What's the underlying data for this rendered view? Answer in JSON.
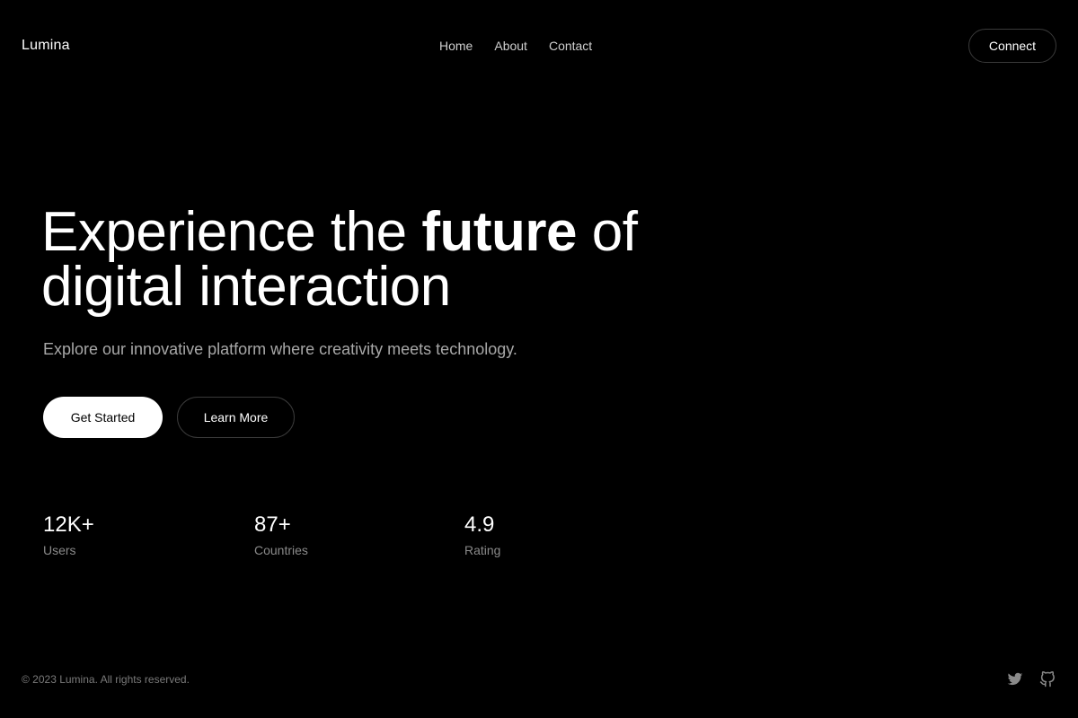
{
  "brand": {
    "name": "Lumina"
  },
  "nav": {
    "items": [
      {
        "label": "Home"
      },
      {
        "label": "About"
      },
      {
        "label": "Contact"
      }
    ]
  },
  "header": {
    "connect_label": "Connect"
  },
  "hero": {
    "title_prefix": "Experience the ",
    "title_emphasis": "future",
    "title_suffix": " of digital interaction",
    "subtitle": "Explore our innovative platform where creativity meets technology.",
    "primary_cta": "Get Started",
    "secondary_cta": "Learn More"
  },
  "stats": [
    {
      "value": "12K+",
      "label": "Users"
    },
    {
      "value": "87+",
      "label": "Countries"
    },
    {
      "value": "4.9",
      "label": "Rating"
    }
  ],
  "footer": {
    "copyright": "© 2023 Lumina. All rights reserved.",
    "icons": [
      "twitter-icon",
      "github-icon"
    ]
  },
  "colors": {
    "background": "#000000",
    "text": "#ffffff",
    "muted": "#a8a8a8",
    "border": "#3a3a3a"
  }
}
